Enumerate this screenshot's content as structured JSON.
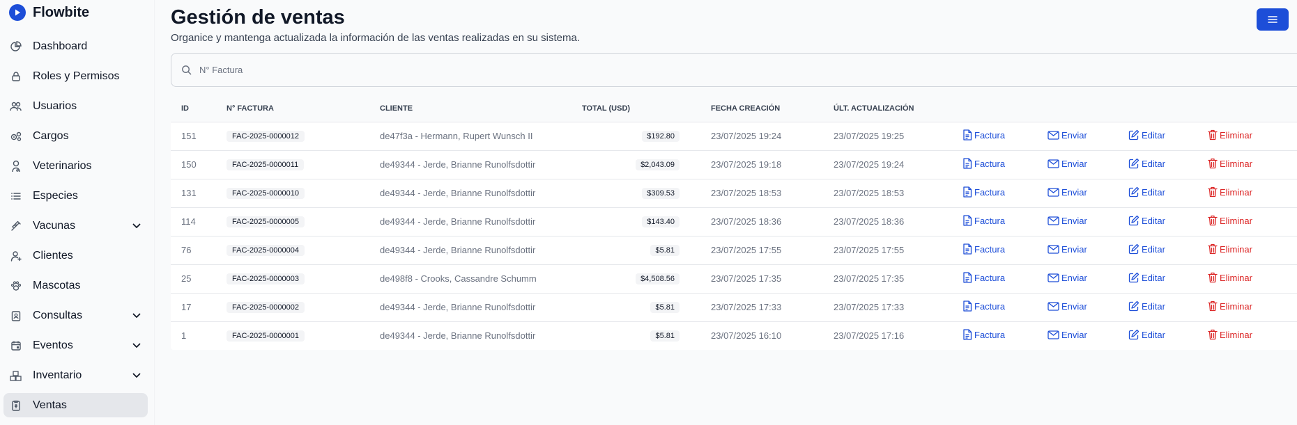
{
  "brand": {
    "name": "Flowbite"
  },
  "sidebar": {
    "items": [
      {
        "label": "Dashboard",
        "icon": "chart-pie-icon",
        "chevron": false,
        "active": false
      },
      {
        "label": "Roles y Permisos",
        "icon": "lock-icon",
        "chevron": false,
        "active": false
      },
      {
        "label": "Usuarios",
        "icon": "users-icon",
        "chevron": false,
        "active": false
      },
      {
        "label": "Cargos",
        "icon": "gears-icon",
        "chevron": false,
        "active": false
      },
      {
        "label": "Veterinarios",
        "icon": "stethoscope-icon",
        "chevron": false,
        "active": false
      },
      {
        "label": "Especies",
        "icon": "list-icon",
        "chevron": false,
        "active": false
      },
      {
        "label": "Vacunas",
        "icon": "syringe-icon",
        "chevron": true,
        "active": false
      },
      {
        "label": "Clientes",
        "icon": "user-icon",
        "chevron": false,
        "active": false
      },
      {
        "label": "Mascotas",
        "icon": "paw-icon",
        "chevron": false,
        "active": false
      },
      {
        "label": "Consultas",
        "icon": "clipboard-user-icon",
        "chevron": true,
        "active": false
      },
      {
        "label": "Eventos",
        "icon": "calendar-icon",
        "chevron": true,
        "active": false
      },
      {
        "label": "Inventario",
        "icon": "boxes-icon",
        "chevron": true,
        "active": false
      },
      {
        "label": "Ventas",
        "icon": "receipt-icon",
        "chevron": false,
        "active": true
      }
    ]
  },
  "header": {
    "title": "Gestión de ventas",
    "subtitle": "Organice y mantenga actualizada la información de las ventas realizadas en su sistema."
  },
  "search": {
    "placeholder": "N° Factura",
    "value": ""
  },
  "table": {
    "columns": [
      "ID",
      "N° Factura",
      "Cliente",
      "Total (USD)",
      "Fecha Creación",
      "Últ. Actualización"
    ],
    "actions": {
      "invoice": "Factura",
      "send": "Enviar",
      "edit": "Editar",
      "delete": "Eliminar"
    },
    "rows": [
      {
        "id": "151",
        "factura": "FAC-2025-0000012",
        "cliente": "de47f3a - Hermann, Rupert Wunsch II",
        "total": "$192.80",
        "creado": "23/07/2025 19:24",
        "actualizado": "23/07/2025 19:25"
      },
      {
        "id": "150",
        "factura": "FAC-2025-0000011",
        "cliente": "de49344 - Jerde, Brianne Runolfsdottir",
        "total": "$2,043.09",
        "creado": "23/07/2025 19:18",
        "actualizado": "23/07/2025 19:24"
      },
      {
        "id": "131",
        "factura": "FAC-2025-0000010",
        "cliente": "de49344 - Jerde, Brianne Runolfsdottir",
        "total": "$309.53",
        "creado": "23/07/2025 18:53",
        "actualizado": "23/07/2025 18:53"
      },
      {
        "id": "114",
        "factura": "FAC-2025-0000005",
        "cliente": "de49344 - Jerde, Brianne Runolfsdottir",
        "total": "$143.40",
        "creado": "23/07/2025 18:36",
        "actualizado": "23/07/2025 18:36"
      },
      {
        "id": "76",
        "factura": "FAC-2025-0000004",
        "cliente": "de49344 - Jerde, Brianne Runolfsdottir",
        "total": "$5.81",
        "creado": "23/07/2025 17:55",
        "actualizado": "23/07/2025 17:55"
      },
      {
        "id": "25",
        "factura": "FAC-2025-0000003",
        "cliente": "de498f8 - Crooks, Cassandre Schumm",
        "total": "$4,508.56",
        "creado": "23/07/2025 17:35",
        "actualizado": "23/07/2025 17:35"
      },
      {
        "id": "17",
        "factura": "FAC-2025-0000002",
        "cliente": "de49344 - Jerde, Brianne Runolfsdottir",
        "total": "$5.81",
        "creado": "23/07/2025 17:33",
        "actualizado": "23/07/2025 17:33"
      },
      {
        "id": "1",
        "factura": "FAC-2025-0000001",
        "cliente": "de49344 - Jerde, Brianne Runolfsdottir",
        "total": "$5.81",
        "creado": "23/07/2025 16:10",
        "actualizado": "23/07/2025 17:16"
      }
    ]
  },
  "colors": {
    "accent": "#1d4ed8",
    "danger": "#dc2626"
  }
}
